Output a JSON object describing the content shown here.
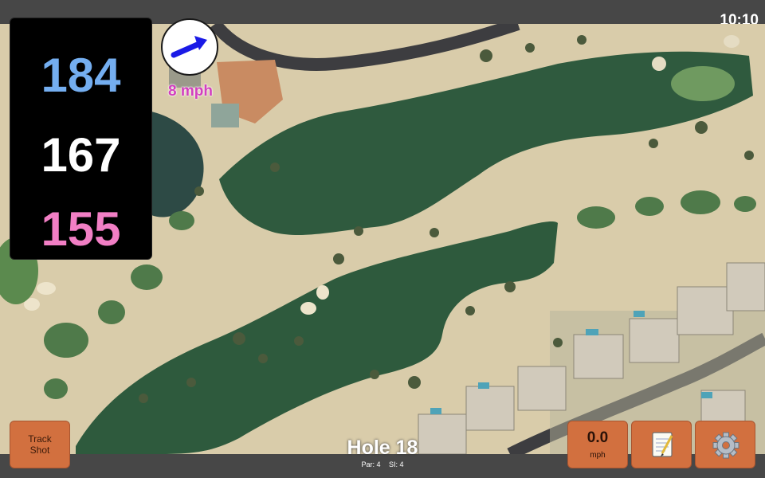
{
  "status_bar": {
    "time": "10:10"
  },
  "distances": {
    "back": "184",
    "middle": "167",
    "front": "155"
  },
  "wind": {
    "speed": "8 mph",
    "icon": "wind-arrow-icon"
  },
  "buttons": {
    "track_shot": "Track\nShot",
    "speed_value": "0.0",
    "speed_unit": "mph",
    "notes_icon": "notepad-icon",
    "settings_icon": "gear-icon"
  },
  "hole": {
    "title": "Hole 18",
    "par": "Par: 4",
    "si": "SI: 4"
  },
  "colors": {
    "back_distance": "#74aef0",
    "middle_distance": "#ffffff",
    "front_distance": "#f27fc5",
    "button_orange": "#d2703f",
    "wind_text": "#d23fbf",
    "fairway": "#2f5a3e",
    "sand": "#d8ccaa"
  }
}
